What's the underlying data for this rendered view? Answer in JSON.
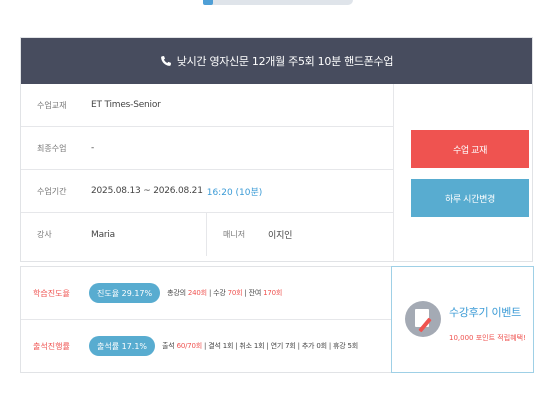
{
  "page": {
    "partial_title_icon": "book-icon"
  },
  "course": {
    "title": "낮시간 영자신문 12개월 주5회 10분 핸드폰수업",
    "header_icon": "phone-icon",
    "rows": {
      "textbook": {
        "label": "수업교재",
        "value": "ET Times-Senior"
      },
      "last_lesson": {
        "label": "최종수업",
        "value": "-"
      },
      "period": {
        "label": "수업기간",
        "value": "2025.08.13 ~ 2026.08.21",
        "time": "16:20 (10분)"
      },
      "teacher": {
        "label": "강사",
        "value": "Maria"
      },
      "manager": {
        "label": "매니저",
        "value": "이지인"
      }
    },
    "buttons": {
      "textbook": "수업 교재",
      "change_time": "하루 시간변경"
    }
  },
  "colors": {
    "header_bg": "#474c5e",
    "accent_red": "#ef5350",
    "accent_blue": "#58acd0"
  },
  "stats": {
    "progress": {
      "label": "학습진도율",
      "pill": "진도율 29.17%",
      "d1": "총강의",
      "d1v": "240회",
      "d2": "| 수강",
      "d2v": "70회",
      "d3": "| 잔여",
      "d3v": "170회"
    },
    "attendance": {
      "label": "출석진행률",
      "pill": "출석률 17.1%",
      "a1": "출석",
      "a1v": "60/70회",
      "a2": "| 결석 1회 | 취소 1회 | 연기 7회 | 추가 0회 | 휴강 5회"
    }
  },
  "event": {
    "icon": "review-pen-icon",
    "title": "수강후기 이벤트",
    "subtitle": "10,000 포인트 적립혜택!"
  }
}
